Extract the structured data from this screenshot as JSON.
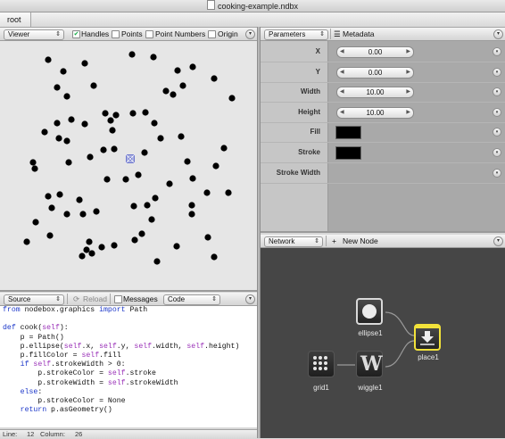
{
  "window": {
    "title": "cooking-example.ndbx"
  },
  "breadcrumb": {
    "root": "root"
  },
  "viewer": {
    "dropdown": "Viewer",
    "options": [
      {
        "label": "Handles",
        "checked": true
      },
      {
        "label": "Points",
        "checked": false
      },
      {
        "label": "Point Numbers",
        "checked": false
      },
      {
        "label": "Origin",
        "checked": false
      }
    ]
  },
  "parameters": {
    "dropdown": "Parameters",
    "metadata_label": "Metadata",
    "rows": [
      {
        "label": "X",
        "value": "0.00",
        "type": "number"
      },
      {
        "label": "Y",
        "value": "0.00",
        "type": "number"
      },
      {
        "label": "Width",
        "value": "10.00",
        "type": "number"
      },
      {
        "label": "Height",
        "value": "10.00",
        "type": "number"
      },
      {
        "label": "Fill",
        "value": "#000000",
        "type": "color"
      },
      {
        "label": "Stroke",
        "value": "#000000",
        "type": "color"
      },
      {
        "label": "Stroke Width",
        "value": "",
        "type": "empty"
      }
    ]
  },
  "network": {
    "dropdown": "Network",
    "new_node": "New Node",
    "nodes": [
      {
        "name": "ellipse1",
        "icon": "ellipse-icon"
      },
      {
        "name": "place1",
        "icon": "place-arrow-icon"
      },
      {
        "name": "grid1",
        "icon": "grid-icon"
      },
      {
        "name": "wiggle1",
        "icon": "wiggle-icon"
      }
    ]
  },
  "source": {
    "dropdown": "Source",
    "reload": "Reload",
    "messages": "Messages",
    "code_dropdown": "Code",
    "lines": [
      "from nodebox.graphics import Path",
      "",
      "def cook(self):",
      "    p = Path()",
      "    p.ellipse(self.x, self.y, self.width, self.height)",
      "    p.fillColor = self.fill",
      "    if self.strokeWidth > 0:",
      "        p.strokeColor = self.stroke",
      "        p.strokeWidth = self.strokeWidth",
      "    else:",
      "        p.strokeColor = None",
      "    return p.asGeometry()"
    ],
    "status": {
      "line_label": "Line:",
      "line": "12",
      "column_label": "Column:",
      "column": "26"
    }
  },
  "colors": {
    "node_highlight": "#f2e23a",
    "canvas": "#e6e6e6",
    "network_bg": "#464646",
    "keyword": "#1c37c9"
  }
}
